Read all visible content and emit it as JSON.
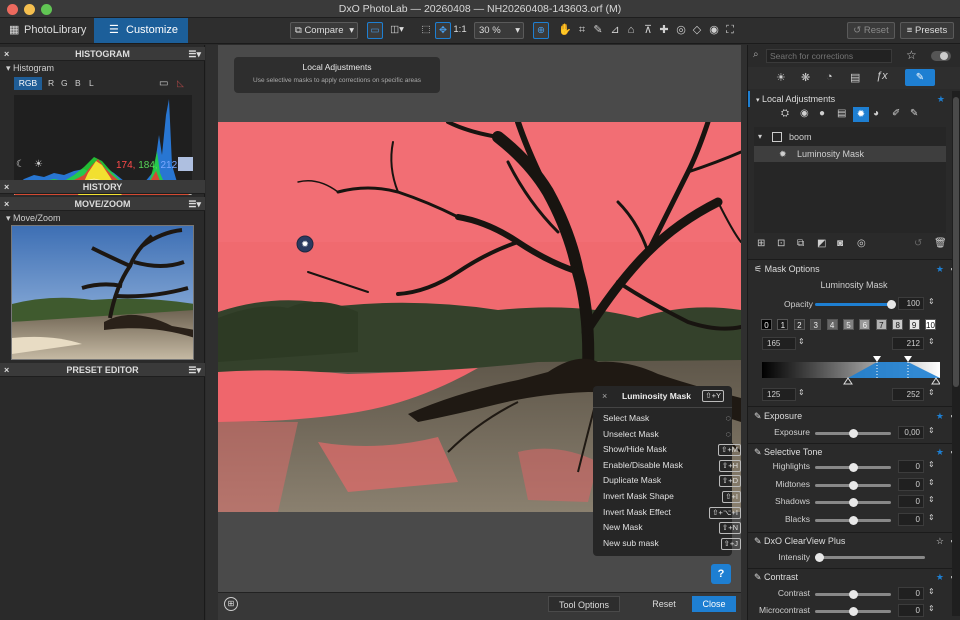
{
  "window": {
    "title": "DxO PhotoLab — 20260408 — NH20260408-143603.orf (M)"
  },
  "tabs": {
    "photolibrary": "PhotoLibrary",
    "customize": "Customize"
  },
  "toolbar": {
    "compare": "Compare",
    "ratio": "1:1",
    "zoom": "30 %",
    "reset": "Reset",
    "presets": "Presets"
  },
  "left": {
    "histogram_header": "HISTOGRAM",
    "histogram_label": "Histogram",
    "channels": [
      "RGB",
      "R",
      "G",
      "B",
      "L"
    ],
    "rgb_values": {
      "r": "174,",
      "g": "184,",
      "b": "212"
    },
    "history_header": "HISTORY",
    "movezoom_header": "MOVE/ZOOM",
    "movezoom_label": "Move/Zoom",
    "preset_header": "PRESET EDITOR"
  },
  "center": {
    "tooltip_title": "Local Adjustments",
    "tooltip_text": "Use selective masks to apply corrections on specific areas",
    "bottom_tool_options": "Tool Options",
    "bottom_reset": "Reset",
    "bottom_close": "Close",
    "help": "?"
  },
  "context_menu": {
    "title": "Luminosity Mask",
    "title_shortcut": "⇧+Y",
    "items": [
      {
        "label": "Select Mask",
        "shortcut": ""
      },
      {
        "label": "Unselect Mask",
        "shortcut": ""
      },
      {
        "label": "Show/Hide Mask",
        "shortcut": "⇧+M"
      },
      {
        "label": "Enable/Disable Mask",
        "shortcut": "⇧+H"
      },
      {
        "label": "Duplicate Mask",
        "shortcut": "⇧+D"
      },
      {
        "label": "Invert Mask Shape",
        "shortcut": "⇧+I"
      },
      {
        "label": "Invert Mask Effect",
        "shortcut": "⇧+⌥+I"
      },
      {
        "label": "New Mask",
        "shortcut": "⇧+N"
      },
      {
        "label": "New sub mask",
        "shortcut": "⇧+J"
      }
    ]
  },
  "right": {
    "search_placeholder": "Search for corrections",
    "local_adj": "Local Adjustments",
    "mask_group": "boom",
    "mask_item": "Luminosity Mask",
    "mask_options": "Mask Options",
    "mask_name": "Luminosity Mask",
    "opacity_label": "Opacity",
    "opacity_value": "100",
    "opacity_fraction": 1.0,
    "zones": [
      "0",
      "1",
      "2",
      "3",
      "4",
      "5",
      "6",
      "7",
      "8",
      "9",
      "10"
    ],
    "range_low": "165",
    "range_high": "212",
    "range_low2": "125",
    "range_high2": "252",
    "exposure_header": "Exposure",
    "exposure_label": "Exposure",
    "exposure_value": "0,00",
    "selective_tone_header": "Selective Tone",
    "tones": [
      {
        "label": "Highlights",
        "value": "0"
      },
      {
        "label": "Midtones",
        "value": "0"
      },
      {
        "label": "Shadows",
        "value": "0"
      },
      {
        "label": "Blacks",
        "value": "0"
      }
    ],
    "clearview_header": "DxO ClearView Plus",
    "intensity_label": "Intensity",
    "intensity_fraction": 0.0,
    "contrast_header": "Contrast",
    "contrast_label": "Contrast",
    "contrast_value": "0",
    "microcontrast_label": "Microcontrast",
    "microcontrast_value": "0"
  },
  "colors": {
    "accent": "#1e7fd2",
    "mask_overlay": "#f06a6f"
  }
}
